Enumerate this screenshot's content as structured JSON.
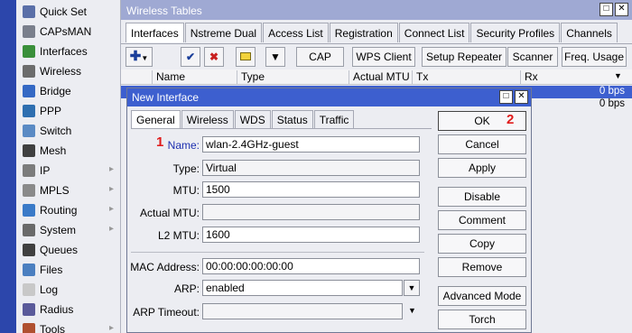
{
  "sidebar": {
    "items": [
      {
        "label": "Quick Set",
        "icon": "quick-set-icon",
        "color": "#5a6fa8",
        "submenu": false
      },
      {
        "label": "CAPsMAN",
        "icon": "capsman-icon",
        "color": "#7a7f8c",
        "submenu": false
      },
      {
        "label": "Interfaces",
        "icon": "interfaces-icon",
        "color": "#3a8f3a",
        "submenu": false
      },
      {
        "label": "Wireless",
        "icon": "wireless-icon",
        "color": "#6c6c6c",
        "submenu": false
      },
      {
        "label": "Bridge",
        "icon": "bridge-icon",
        "color": "#3569c4",
        "submenu": false
      },
      {
        "label": "PPP",
        "icon": "ppp-icon",
        "color": "#2f6fb0",
        "submenu": false
      },
      {
        "label": "Switch",
        "icon": "switch-icon",
        "color": "#5a8ac4",
        "submenu": false
      },
      {
        "label": "Mesh",
        "icon": "mesh-icon",
        "color": "#404040",
        "submenu": false
      },
      {
        "label": "IP",
        "icon": "ip-icon",
        "color": "#7c7c7c",
        "submenu": true
      },
      {
        "label": "MPLS",
        "icon": "mpls-icon",
        "color": "#8a8a8a",
        "submenu": true
      },
      {
        "label": "Routing",
        "icon": "routing-icon",
        "color": "#3a7ac8",
        "submenu": true
      },
      {
        "label": "System",
        "icon": "system-icon",
        "color": "#6a6a6a",
        "submenu": true
      },
      {
        "label": "Queues",
        "icon": "queues-icon",
        "color": "#404040",
        "submenu": false
      },
      {
        "label": "Files",
        "icon": "files-icon",
        "color": "#4b7fc0",
        "submenu": false
      },
      {
        "label": "Log",
        "icon": "log-icon",
        "color": "#c8c8c8",
        "submenu": false
      },
      {
        "label": "Radius",
        "icon": "radius-icon",
        "color": "#5a5a9a",
        "submenu": false
      },
      {
        "label": "Tools",
        "icon": "tools-icon",
        "color": "#b05030",
        "submenu": true
      }
    ]
  },
  "wireless_tables": {
    "title": "Wireless Tables",
    "tabs": [
      "Interfaces",
      "Nstreme Dual",
      "Access List",
      "Registration",
      "Connect List",
      "Security Profiles",
      "Channels"
    ],
    "toolbar": {
      "cap": "CAP",
      "wps_client": "WPS Client",
      "setup_repeater": "Setup Repeater",
      "scanner": "Scanner",
      "freq_usage": "Freq. Usage"
    },
    "columns": [
      "Name",
      "Type",
      "Actual MTU",
      "Tx",
      "Rx"
    ],
    "rows": [
      {
        "rx": "0 bps"
      },
      {
        "rx": "0 bps"
      }
    ]
  },
  "dialog": {
    "title": "New Interface",
    "tabs": [
      "General",
      "Wireless",
      "WDS",
      "Status",
      "Traffic"
    ],
    "fields": {
      "name": {
        "label": "Name:",
        "value": "wlan-2.4GHz-guest"
      },
      "type": {
        "label": "Type:",
        "value": "Virtual"
      },
      "mtu": {
        "label": "MTU:",
        "value": "1500"
      },
      "actual_mtu": {
        "label": "Actual MTU:",
        "value": ""
      },
      "l2_mtu": {
        "label": "L2 MTU:",
        "value": "1600"
      },
      "mac_address": {
        "label": "MAC Address:",
        "value": "00:00:00:00:00:00"
      },
      "arp": {
        "label": "ARP:",
        "value": "enabled"
      },
      "arp_timeout": {
        "label": "ARP Timeout:",
        "value": ""
      }
    },
    "buttons": {
      "ok": "OK",
      "cancel": "Cancel",
      "apply": "Apply",
      "disable": "Disable",
      "comment": "Comment",
      "copy": "Copy",
      "remove": "Remove",
      "advanced_mode": "Advanced Mode",
      "torch": "Torch"
    },
    "markers": {
      "step1": "1",
      "step2": "2"
    }
  },
  "colors": {
    "sidebar_strip": "#2c46ab",
    "title_active": "#3d5fcf",
    "title_inactive": "#9fa9d3",
    "marker": "#e01b1b"
  }
}
